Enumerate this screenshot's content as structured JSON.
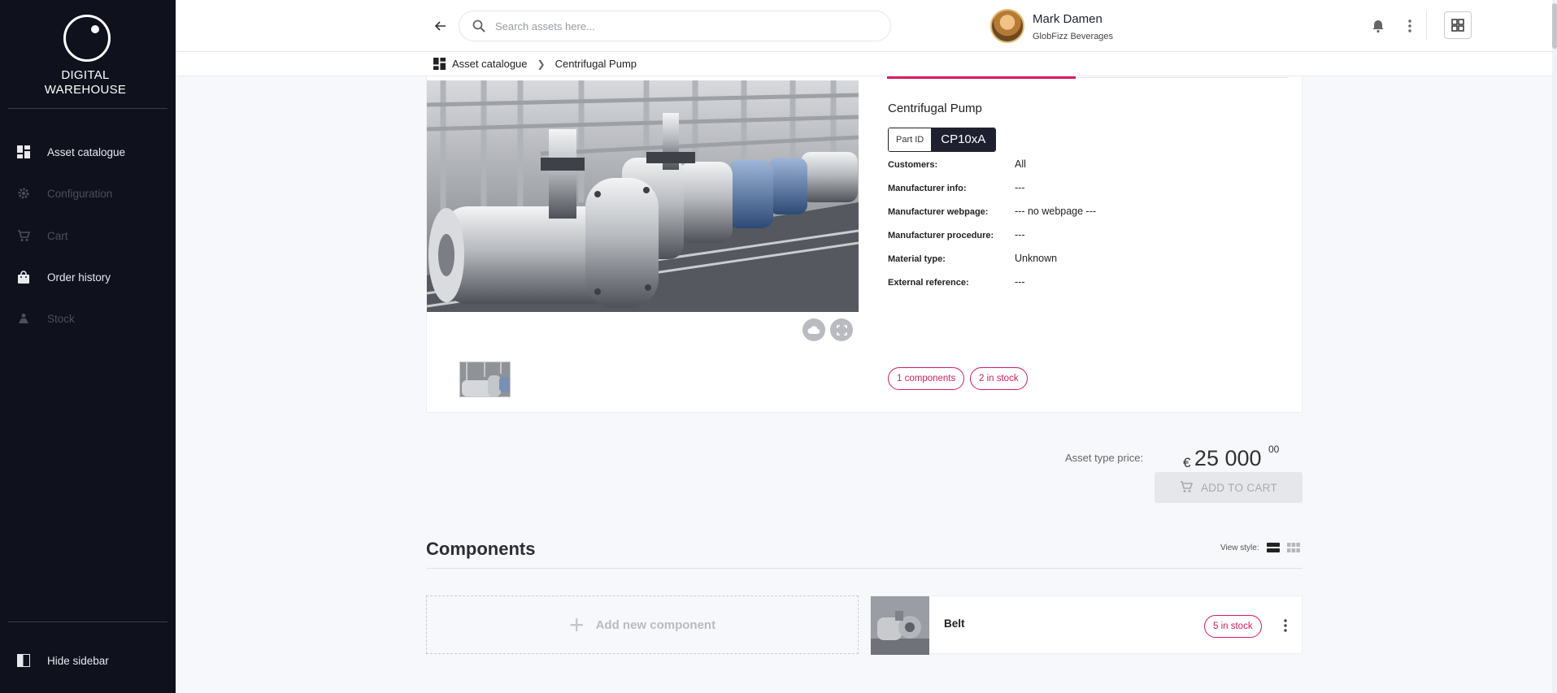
{
  "app": {
    "logo_line1": "DIGITAL",
    "logo_line2": "WAREHOUSE"
  },
  "sidebar": {
    "items": [
      {
        "label": "Asset catalogue",
        "icon": "dashboard-icon",
        "state": "active"
      },
      {
        "label": "Configuration",
        "icon": "gear-icon",
        "state": "disabled"
      },
      {
        "label": "Cart",
        "icon": "cart-icon",
        "state": "disabled"
      },
      {
        "label": "Order history",
        "icon": "shopping-bag-icon",
        "state": "active"
      },
      {
        "label": "Stock",
        "icon": "stock-icon",
        "state": "disabled"
      }
    ],
    "hide_label": "Hide sidebar"
  },
  "header": {
    "search_placeholder": "Search assets here...",
    "user_name": "Mark Damen",
    "user_org": "GlobFizz Beverages"
  },
  "breadcrumb": {
    "root": "Asset catalogue",
    "current": "Centrifugal Pump"
  },
  "asset": {
    "title": "Centrifugal Pump",
    "part_id_label": "Part ID",
    "part_id": "CP10xA",
    "properties": [
      {
        "key": "Customers:",
        "value": "All"
      },
      {
        "key": "Manufacturer info:",
        "value": "---"
      },
      {
        "key": "Manufacturer webpage:",
        "value": "--- no webpage ---"
      },
      {
        "key": "Manufacturer procedure:",
        "value": "---"
      },
      {
        "key": "Material type:",
        "value": "Unknown"
      },
      {
        "key": "External reference:",
        "value": "---"
      }
    ],
    "chips": {
      "components": "1 components",
      "stock": "2 in stock"
    }
  },
  "pricing": {
    "label": "Asset type price:",
    "currency": "€",
    "integer": "25 000",
    "decimal": "00",
    "add_to_cart": "ADD TO CART"
  },
  "components": {
    "title": "Components",
    "view_style_label": "View style:",
    "add_label": "Add new component",
    "items": [
      {
        "name": "Belt",
        "stock": "5 in stock"
      }
    ]
  },
  "colors": {
    "accent": "#d81b60",
    "sidebar_bg": "#0f111c",
    "page_bg": "#f7f8fb"
  }
}
